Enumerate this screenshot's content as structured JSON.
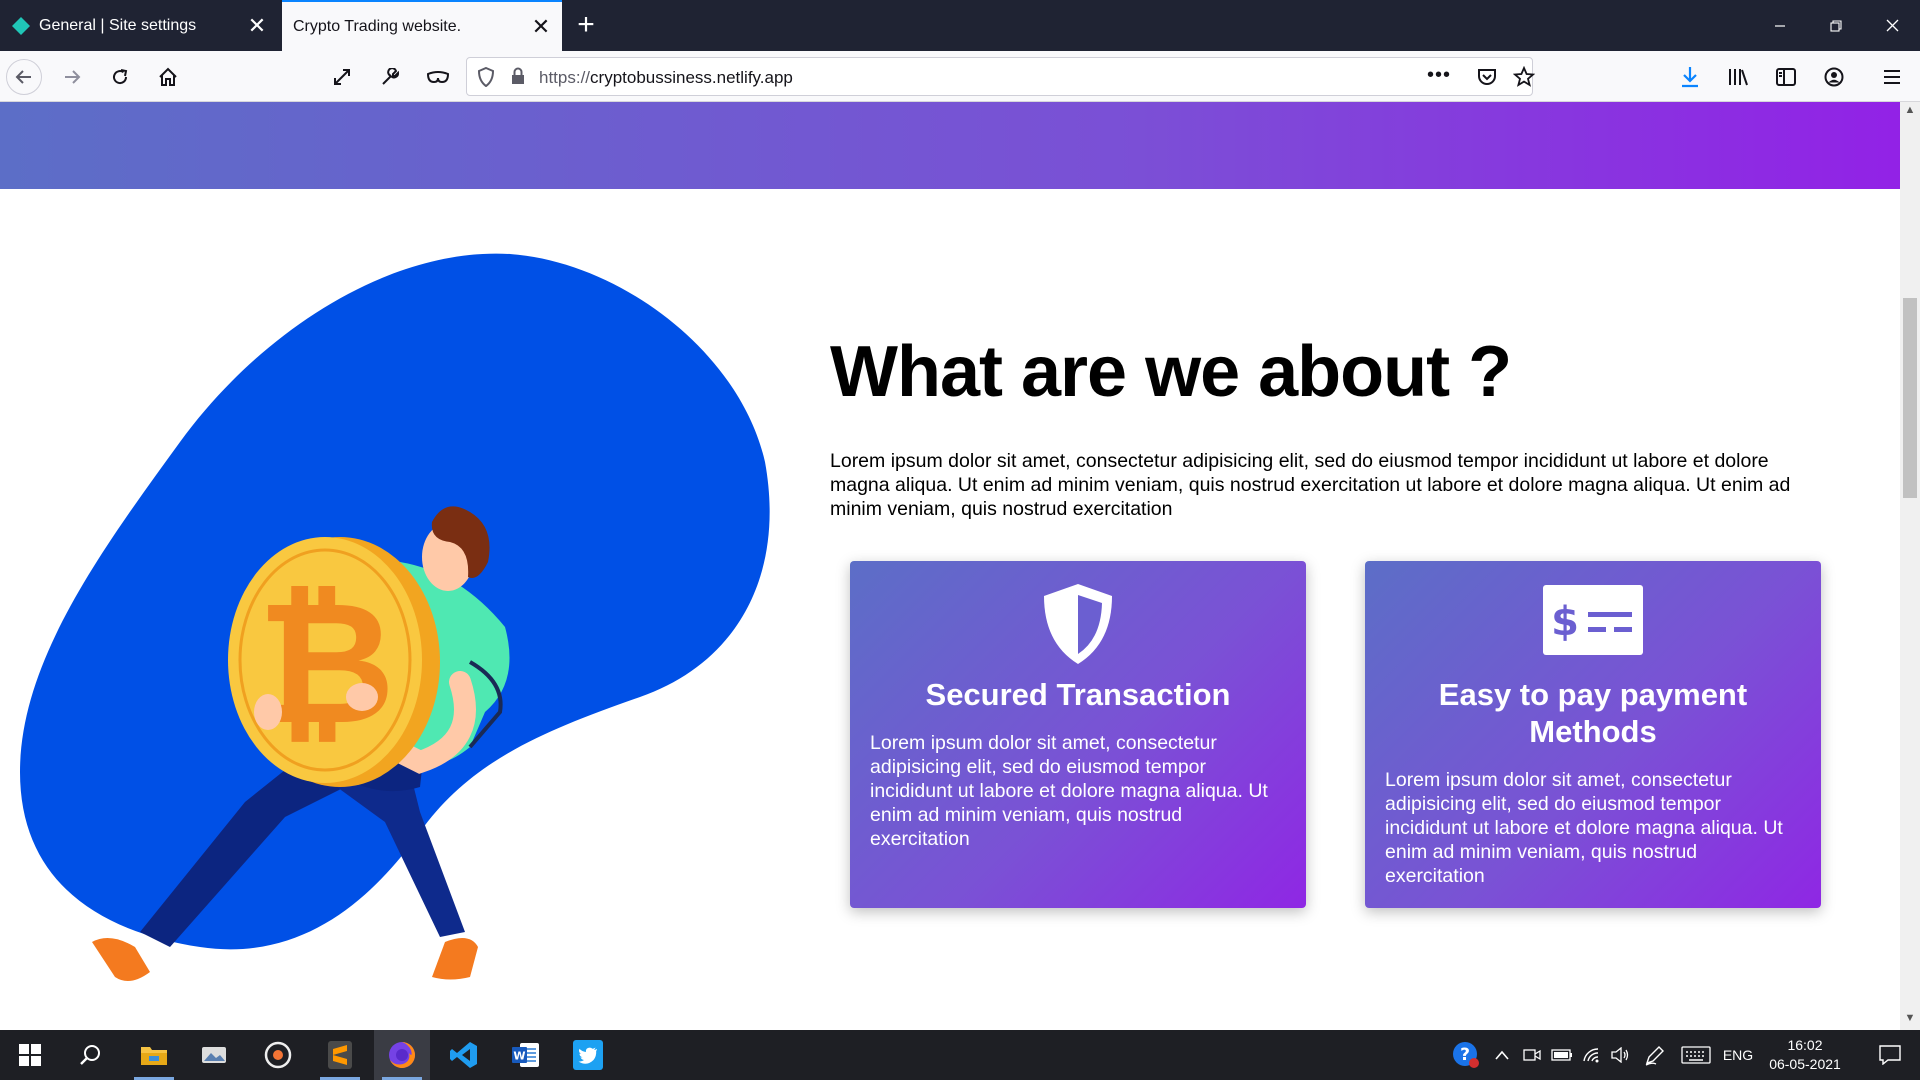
{
  "browser": {
    "tabs": [
      {
        "title": "General | Site settings",
        "active": false,
        "favicon": "netlify-diamond-icon"
      },
      {
        "title": "Crypto Trading website.",
        "active": true
      }
    ],
    "url": {
      "prefix": "https://",
      "host": "cryptobussiness.netlify.app"
    }
  },
  "page": {
    "heading": "What are we about ?",
    "intro": "Lorem ipsum dolor sit amet, consectetur adipisicing elit, sed do eiusmod tempor incididunt ut labore et dolore magna aliqua. Ut enim ad minim veniam, quis nostrud exercitation ut labore et dolore magna aliqua. Ut enim ad minim veniam, quis nostrud exercitation",
    "cards": [
      {
        "icon": "shield-icon",
        "title": "Secured Transaction",
        "body": "Lorem ipsum dolor sit amet, consectetur adipisicing elit, sed do eiusmod tempor incididunt ut labore et dolore magna aliqua. Ut enim ad minim veniam, quis nostrud exercitation"
      },
      {
        "icon": "payment-card-icon",
        "title": "Easy to pay payment Methods",
        "body": "Lorem ipsum dolor sit amet, consectetur adipisicing elit, sed do eiusmod tempor incididunt ut labore et dolore magna aliqua. Ut enim ad minim veniam, quis nostrud exercitation"
      }
    ],
    "colors": {
      "gradient_start": "#5c6ec7",
      "gradient_end": "#9222e6",
      "blob": "#0050e6",
      "coin": "#f9c840"
    }
  },
  "taskbar": {
    "apps": [
      "start-icon",
      "search-icon",
      "file-explorer-icon",
      "photos-icon",
      "media-icon",
      "sublime-text-icon",
      "firefox-icon",
      "vscode-icon",
      "word-icon",
      "twitter-icon"
    ],
    "language": "ENG",
    "time": "16:02",
    "date": "06-05-2021"
  }
}
